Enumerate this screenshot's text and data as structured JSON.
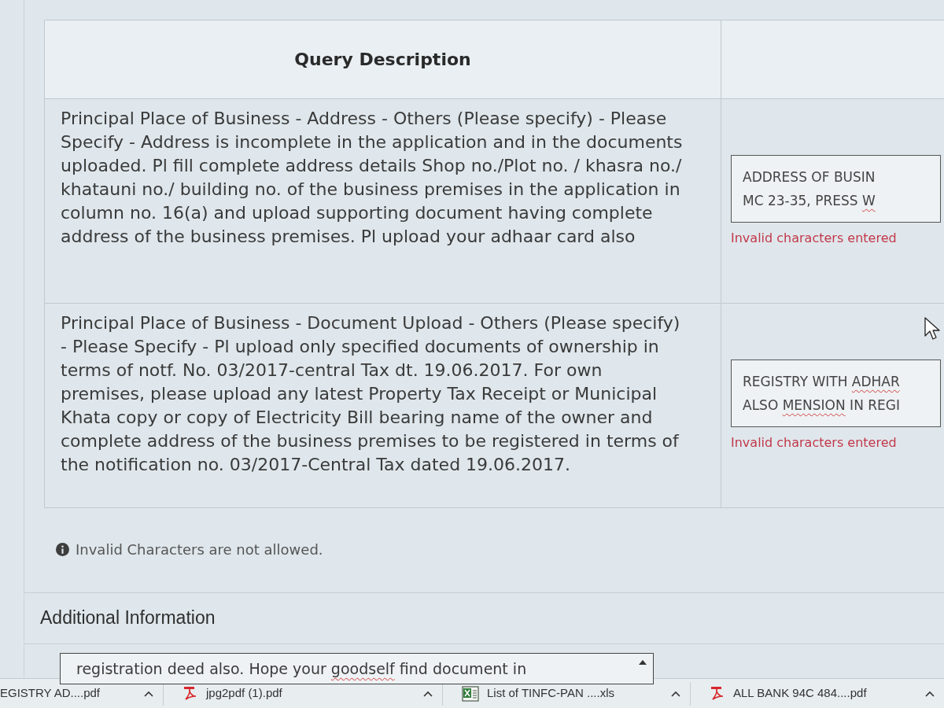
{
  "query_table": {
    "heading": "Query Description",
    "rows": [
      {
        "description": "Principal Place of Business - Address - Others (Please specify) - Please Specify - Address is incomplete in the application and in the documents uploaded. Pl fill complete address details Shop no./Plot no. / khasra no./ khatauni no./ building no. of the business premises in the application in column no. 16(a) and upload supporting document having complete address of the business premises. Pl upload your adhaar card also",
        "response": {
          "lines": [
            {
              "segments": [
                {
                  "text": "ADDRESS OF BUSIN",
                  "misspelled": false
                }
              ]
            },
            {
              "segments": [
                {
                  "text": "MC 23-35, PRESS ",
                  "misspelled": false
                },
                {
                  "text": "W",
                  "misspelled": true
                }
              ]
            }
          ],
          "error": "Invalid characters entered"
        }
      },
      {
        "description": "Principal Place of Business - Document Upload - Others (Please specify) - Please Specify - Pl upload only specified documents of ownership in terms of notf. No. 03/2017-central Tax dt. 19.06.2017. For own premises, please upload any latest Property Tax Receipt or Municipal Khata copy or copy of Electricity Bill bearing name of the owner and complete address of the business premises to be registered in terms of the notification no. 03/2017-Central Tax dated 19.06.2017.",
        "response": {
          "lines": [
            {
              "segments": [
                {
                  "text": "REGISTRY WITH ",
                  "misspelled": false
                },
                {
                  "text": "ADHAR",
                  "misspelled": true
                }
              ]
            },
            {
              "segments": [
                {
                  "text": "ALSO ",
                  "misspelled": false
                },
                {
                  "text": "MENSION",
                  "misspelled": true
                },
                {
                  "text": " IN REGI",
                  "misspelled": false
                }
              ]
            }
          ],
          "error": "Invalid characters entered"
        }
      }
    ]
  },
  "notice": {
    "text": "Invalid Characters are not allowed."
  },
  "additional_information": {
    "title": "Additional Information",
    "field": {
      "segments": [
        {
          "text": "registration deed also. Hope your ",
          "misspelled": false
        },
        {
          "text": "goodself",
          "misspelled": true
        },
        {
          "text": " find document in",
          "misspelled": false
        }
      ]
    }
  },
  "downloads": [
    {
      "name": "EGISTRY AD....pdf",
      "kind": "clipped"
    },
    {
      "name": "jpg2pdf (1).pdf",
      "kind": "pdf"
    },
    {
      "name": "List of TINFC-PAN ....xls",
      "kind": "xls"
    },
    {
      "name": "ALL BANK 94C 484....pdf",
      "kind": "pdf"
    }
  ]
}
